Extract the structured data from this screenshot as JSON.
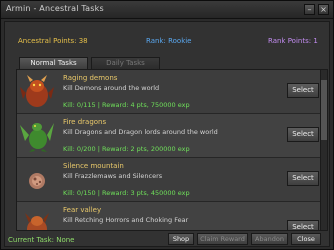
{
  "window": {
    "title": "Armin - Ancestral Tasks"
  },
  "info": {
    "points_label": "Ancestral Points: 38",
    "rank_label": "Rank: Rookie",
    "rank_points_label": "Rank Points: 1"
  },
  "colors": {
    "points": "#e6c04a",
    "rank": "#5aa8f0",
    "rank_points": "#c28cf0",
    "quest_name": "#e8c86a",
    "reward": "#6fe05a"
  },
  "tabs": [
    {
      "label": "Normal Tasks",
      "active": true
    },
    {
      "label": "Daily Tasks",
      "active": false
    }
  ],
  "tasks": [
    {
      "name": "Raging demons",
      "description": "Kill Demons around the world",
      "reward": "Kill: 0/115 | Reward: 4 pts, 750000 exp",
      "icon": "demon-icon",
      "select_label": "Select"
    },
    {
      "name": "Fire dragons",
      "description": "Kill Dragons and Dragon lords around the world",
      "reward": "Kill: 0/200 | Reward: 2 pts, 200000 exp",
      "icon": "dragon-icon",
      "select_label": "Select"
    },
    {
      "name": "Silence mountain",
      "description": "Kill Frazzlemaws and Silencers",
      "reward": "Kill: 0/150 | Reward: 3 pts, 450000 exp",
      "icon": "silencer-icon",
      "select_label": "Select"
    },
    {
      "name": "Fear valley",
      "description": "Kill Retching Horrors and Choking Fear",
      "reward": "",
      "icon": "fear-creature-icon",
      "select_label": "Select"
    }
  ],
  "footer": {
    "current_task": "Current Task: None",
    "buttons": {
      "shop": "Shop",
      "claim": "Claim Reward",
      "abandon": "Abandon",
      "close": "Close"
    }
  }
}
